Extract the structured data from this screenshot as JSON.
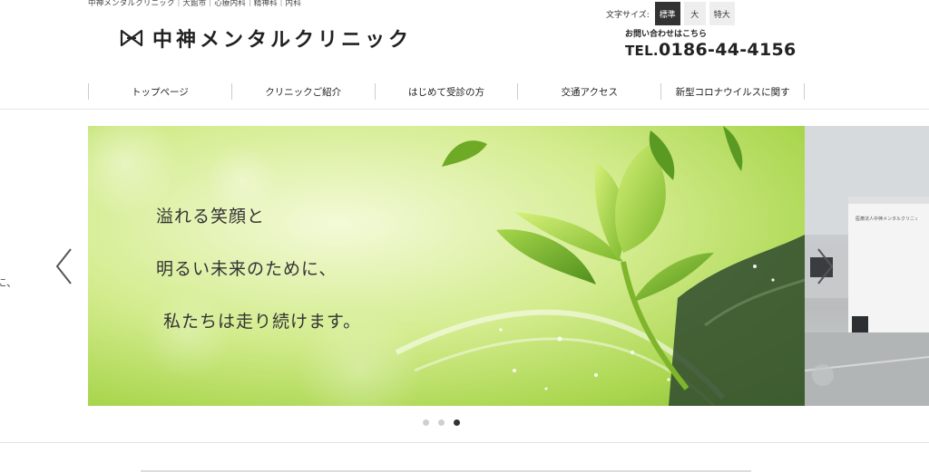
{
  "header": {
    "tagline": "中神メンタルクリニック｜大館市｜心療内科｜精神科｜内科",
    "logo_text": "中神メンタルクリニック",
    "font_size": {
      "label": "文字サイズ:",
      "options": [
        "標準",
        "大",
        "特大"
      ],
      "selected": "標準"
    },
    "contact_label": "お問い合わせはこちら",
    "tel_prefix": "TEL.",
    "tel_number": "0186-44-4156"
  },
  "nav": {
    "items": [
      {
        "label": "トップページ"
      },
      {
        "label": "クリニックご紹介"
      },
      {
        "label": "はじめて受診の方"
      },
      {
        "label": "交通アクセス"
      },
      {
        "label": "新型コロナウイルスに関す"
      }
    ]
  },
  "slider": {
    "prev_fragment": "に、",
    "lines": [
      "溢れる笑顔と",
      "明るい未来のために、",
      "私たちは走り続けます。"
    ],
    "next_building_sign": "医療法人中神メンタルクリニック",
    "dots": 3,
    "active_dot_index": 2
  },
  "colors": {
    "accent_dark": "#333333",
    "slide_green": "#a9d64e"
  }
}
